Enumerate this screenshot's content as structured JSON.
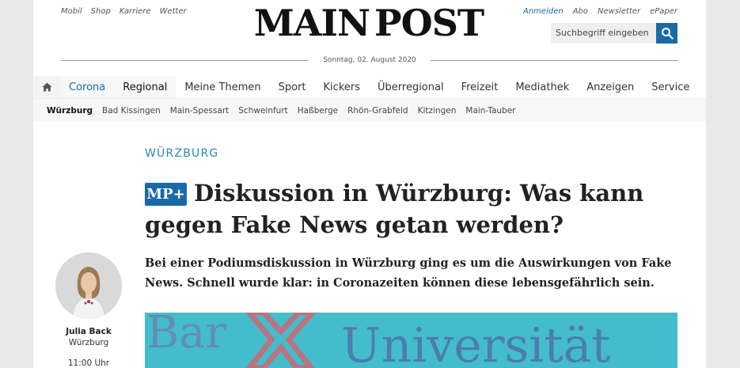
{
  "topbar": {
    "left_links": [
      "Mobil",
      "Shop",
      "Karriere",
      "Wetter"
    ],
    "right_links": [
      "Anmelden",
      "Abo",
      "Newsletter",
      "ePaper"
    ]
  },
  "logo": {
    "left": "MAIN",
    "right": "POST"
  },
  "search": {
    "placeholder": "Suchbegriff eingeben",
    "icon": "search-icon"
  },
  "date": "Sonntag, 02. August 2020",
  "nav": {
    "home_icon": "home-icon",
    "items": [
      "Corona",
      "Regional",
      "Meine Themen",
      "Sport",
      "Kickers",
      "Überregional",
      "Freizeit",
      "Mediathek",
      "Anzeigen",
      "Service"
    ]
  },
  "subnav": {
    "items": [
      "Würzburg",
      "Bad Kissingen",
      "Main-Spessart",
      "Schweinfurt",
      "Haßberge",
      "Rhön-Grabfeld",
      "Kitzingen",
      "Main-Tauber"
    ]
  },
  "article": {
    "kicker": "WÜRZBURG",
    "badge": "MP+",
    "headline": "Diskussion in Würzburg: Was kann gegen Fake News getan werden?",
    "teaser": "Bei einer Podiumsdiskussion in Würzburg ging es um die Auswirkungen von Fake News. Schnell wurde klar: in Coronazeiten können diese lebensgefährlich sein.",
    "author": {
      "name": "Julia Back",
      "city": "Würzburg",
      "time": "11:00 Uhr"
    }
  },
  "colors": {
    "accent": "#1a6aa8",
    "kicker": "#2b8bb0",
    "hero": "#3cb8c6"
  }
}
